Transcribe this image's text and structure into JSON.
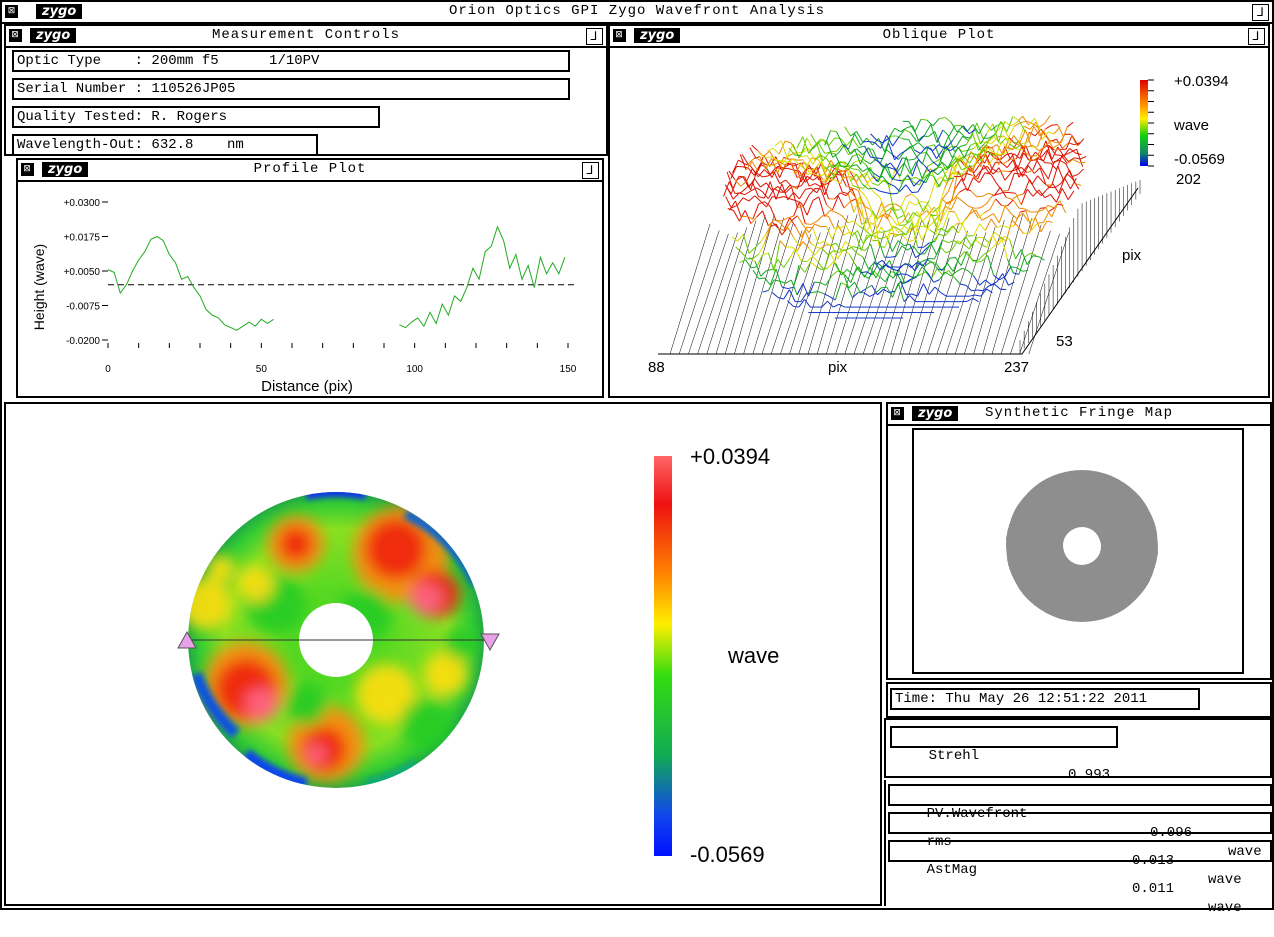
{
  "app": {
    "title": "Orion Optics GPI Zygo Wavefront Analysis",
    "logo": "zygo",
    "close_icon_glyph": "⊠",
    "menu_icon_glyph": "⅃"
  },
  "measurement_controls": {
    "title": "Measurement Controls",
    "optic_type": "Optic Type    : 200mm f5      1/10PV",
    "serial_number": "Serial Number : 110526JP05",
    "quality_tested": "Quality Tested: R. Rogers",
    "wavelength": "Wavelength-Out: 632.8    nm"
  },
  "profile_plot": {
    "title": "Profile Plot",
    "ylabel": "Height (wave)",
    "xlabel": "Distance (pix)",
    "yticks": [
      "+0.0300",
      "+0.0175",
      "+0.0050",
      "-0.0075",
      "-0.0200"
    ],
    "xticks": [
      "0",
      "50",
      "100",
      "150"
    ]
  },
  "oblique_plot": {
    "title": "Oblique Plot",
    "scale_max": "+0.0394",
    "scale_unit": "wave",
    "scale_min": "-0.0569",
    "y_far": "202",
    "y_label": "pix",
    "y_near": "53",
    "x_left": "88",
    "x_label": "pix",
    "x_right": "237"
  },
  "surface_map": {
    "scale_max": "+0.0394",
    "scale_unit": "wave",
    "scale_min": "-0.0569"
  },
  "fringe_map": {
    "title": "Synthetic Fringe Map"
  },
  "time": {
    "text": "Time: Thu May 26 12:51:22 2011"
  },
  "results": {
    "strehl": {
      "label": "Strehl",
      "value": "0.993"
    },
    "pv": {
      "label": "PV.Wavefront",
      "value": "0.096",
      "unit": "wave"
    },
    "rms": {
      "label": "rms",
      "value": "0.013",
      "unit": "wave"
    },
    "astmag": {
      "label": "AstMag",
      "value": "0.011",
      "unit": "wave"
    }
  },
  "colors": {
    "high": "#e01010",
    "mid": "#10c010",
    "low": "#1010e0",
    "profile_line": "#22aa22"
  },
  "chart_data": {
    "type": "line",
    "xlabel": "Distance (pix)",
    "ylabel": "Height (wave)",
    "xlim": [
      0,
      150
    ],
    "ylim": [
      -0.02,
      0.03
    ],
    "reference_line": 0.0,
    "segments": [
      {
        "x": [
          0,
          2,
          4,
          6,
          8,
          10,
          12,
          14,
          16,
          18,
          20,
          22,
          24,
          26,
          28,
          30,
          32,
          34,
          36,
          38,
          40,
          42,
          44,
          46,
          48,
          50,
          52,
          54
        ],
        "y": [
          0.0055,
          0.0045,
          -0.003,
          0.0,
          0.005,
          0.009,
          0.012,
          0.0165,
          0.0175,
          0.016,
          0.011,
          0.008,
          0.002,
          0.003,
          -0.001,
          -0.004,
          -0.009,
          -0.011,
          -0.012,
          -0.0145,
          -0.0155,
          -0.0165,
          -0.015,
          -0.0135,
          -0.015,
          -0.0125,
          -0.014,
          -0.0125
        ]
      },
      {
        "x": [
          95,
          97,
          99,
          101,
          103,
          105,
          107,
          109,
          111,
          113,
          115,
          117,
          119,
          121,
          123,
          125,
          127,
          129,
          131,
          133,
          135,
          137,
          139,
          141,
          143,
          145,
          147,
          149
        ],
        "y": [
          -0.0145,
          -0.0155,
          -0.0135,
          -0.012,
          -0.015,
          -0.01,
          -0.014,
          -0.007,
          -0.011,
          -0.004,
          -0.006,
          -0.001,
          0.006,
          0.002,
          0.012,
          0.014,
          0.021,
          0.016,
          0.006,
          0.011,
          0.002,
          0.007,
          -0.001,
          0.01,
          0.004,
          0.008,
          0.004,
          0.01
        ]
      }
    ]
  }
}
